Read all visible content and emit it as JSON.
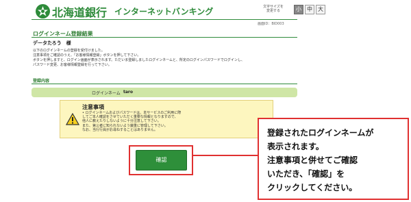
{
  "header": {
    "bank_name": "北海道銀行",
    "service_name": "インターネットバンキング",
    "font_size_label": "文字サイズを変更する",
    "font_size_buttons": [
      "小",
      "中",
      "大"
    ],
    "screen_id": "画面ID：BID003"
  },
  "page": {
    "title": "ログインネーム登録結果",
    "customer_name": "データたろう　様",
    "description_lines": [
      "以下のログインネームの登録を受付けました。",
      "注意事項をご確認のうえ、「お客様情報登録」ボタンを押して下さい。",
      "ボタンを押しますと、ログイン画面が表示されます。ただいま登録しましたログインネームと、所定のログインパスワードでログインし、",
      "パスワード変更、お客様情報登録を行って下さい。"
    ]
  },
  "registration": {
    "section_title": "登録内容",
    "login_label": "ログインネーム",
    "login_value": "taro"
  },
  "caution": {
    "title": "注意事項",
    "lines": [
      "• ログインネームおよびパスワードは、本サービスのご利用に際",
      "  してご本人確認をさせていただく重要な情報となりますので、",
      "  他人に教えたりしないように十分注意して下さい。",
      "  また、第三者に知られないよう厳重に管理して下さい。",
      "  なお、当行行員がお尋ねすることはありません。"
    ]
  },
  "confirm_button": {
    "label": "確認"
  },
  "callout": {
    "lines": [
      "登録されたログインネームが",
      "表示されます。",
      "注意事項と併せてご確認",
      "いただき、「確認」を",
      "クリックしてください。"
    ]
  },
  "colors": {
    "brand_green": "#2e8b3a",
    "highlight_red": "#e03030",
    "caution_bg": "#fdf6bf",
    "login_row_bg": "#cfe6a6"
  }
}
